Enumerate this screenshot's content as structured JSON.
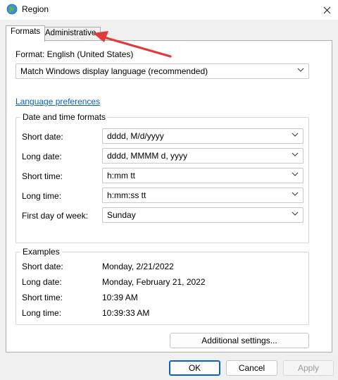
{
  "window": {
    "title": "Region"
  },
  "tabs": [
    {
      "label": "Formats"
    },
    {
      "label": "Administrative"
    }
  ],
  "format": {
    "label": "Format: English (United States)",
    "value": "Match Windows display language (recommended)"
  },
  "language_link": "Language preferences",
  "date_time_formats": {
    "legend": "Date and time formats",
    "rows": [
      {
        "label": "Short date:",
        "value": "dddd, M/d/yyyy"
      },
      {
        "label": "Long date:",
        "value": "dddd, MMMM d, yyyy"
      },
      {
        "label": "Short time:",
        "value": "h:mm tt"
      },
      {
        "label": "Long time:",
        "value": "h:mm:ss tt"
      },
      {
        "label": "First day of week:",
        "value": "Sunday"
      }
    ]
  },
  "examples": {
    "legend": "Examples",
    "rows": [
      {
        "label": "Short date:",
        "value": "Monday, 2/21/2022"
      },
      {
        "label": "Long date:",
        "value": "Monday, February 21, 2022"
      },
      {
        "label": "Short time:",
        "value": "10:39 AM"
      },
      {
        "label": "Long time:",
        "value": "10:39:33 AM"
      }
    ]
  },
  "buttons": {
    "additional": "Additional settings...",
    "ok": "OK",
    "cancel": "Cancel",
    "apply": "Apply"
  },
  "colors": {
    "link": "#0a5fc7",
    "annotation_arrow": "#e03a3a"
  },
  "icons": {
    "title": "globe-icon",
    "close": "close-icon",
    "dropdown": "chevron-down-icon"
  }
}
